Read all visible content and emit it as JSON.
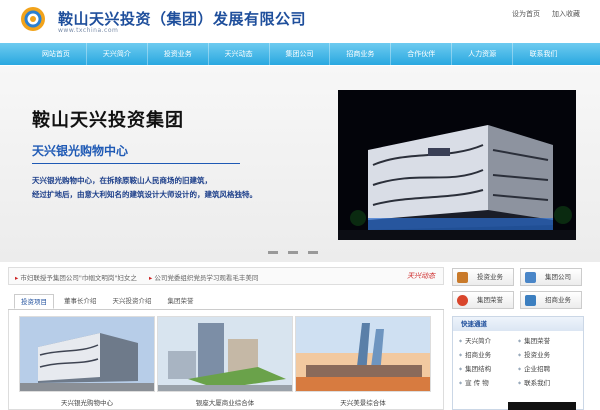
{
  "header": {
    "company_name": "鞍山天兴投资（集团）发展有限公司",
    "domain": "www.txchina.com",
    "links": [
      "设为首页",
      "加入收藏"
    ]
  },
  "nav": {
    "items": [
      "网站首页",
      "天兴简介",
      "投资业务",
      "天兴动态",
      "集团公司",
      "招商业务",
      "合作伙伴",
      "人力资源",
      "联系我们"
    ]
  },
  "banner": {
    "title": "鞍山天兴投资集团",
    "subtitle": "天兴银光购物中心",
    "desc_line1": "天兴银光购物中心，在拆除原鞍山人民商场的旧建筑，",
    "desc_line2": "经过扩地后，由意大利知名的建筑设计大师设计的，建筑风格独特。"
  },
  "news": {
    "items": [
      "市妇联授予集团公司\"巾帼文明岗\"妇女之",
      "公司党委组织党员学习观看毛丰美同"
    ],
    "tag": "天兴动态"
  },
  "tabs": [
    "投资项目",
    "董事长介绍",
    "天兴投资介绍",
    "集团荣誉"
  ],
  "projects": [
    {
      "caption": "天兴银光购物中心"
    },
    {
      "caption": "银座大厦商业综合体"
    },
    {
      "caption": "天兴美景综合体"
    }
  ],
  "quick_buttons": [
    {
      "label": "投资业务",
      "icon": "briefcase-icon",
      "color": "#c97a2a"
    },
    {
      "label": "集团公司",
      "icon": "building-icon",
      "color": "#4a86c8"
    },
    {
      "label": "集团荣誉",
      "icon": "award-icon",
      "color": "#d9452b"
    },
    {
      "label": "招商业务",
      "icon": "handshake-icon",
      "color": "#3c7fc0"
    }
  ],
  "fast_channel": {
    "title": "快速通道",
    "items": [
      "天兴简介",
      "集团荣誉",
      "招商业务",
      "投资业务",
      "集团结构",
      "企业招聘",
      "宣 传 物",
      "联系我们"
    ]
  },
  "colors": {
    "brand_blue": "#1f4f9c",
    "nav_blue": "#29a8e0",
    "accent_red": "#cc2222"
  }
}
